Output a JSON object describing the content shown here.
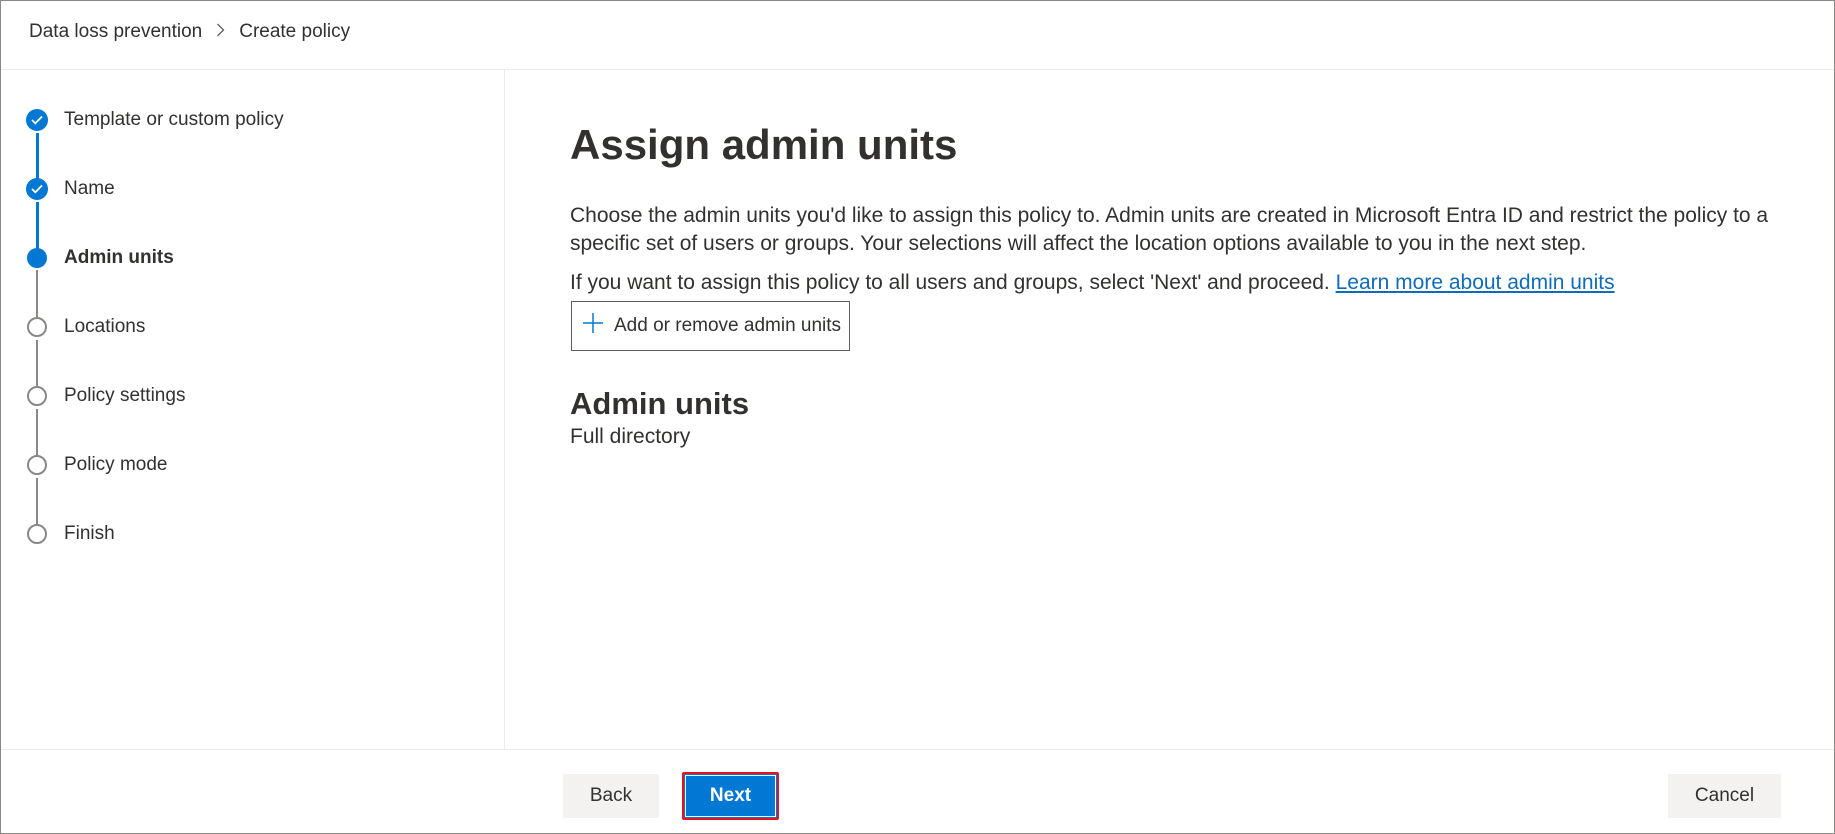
{
  "breadcrumb": {
    "items": [
      "Data loss prevention",
      "Create policy"
    ],
    "separator_icon": "chevron-right-icon"
  },
  "wizard": {
    "steps": [
      {
        "label": "Template or custom policy",
        "state": "completed"
      },
      {
        "label": "Name",
        "state": "completed"
      },
      {
        "label": "Admin units",
        "state": "current"
      },
      {
        "label": "Locations",
        "state": "not-started"
      },
      {
        "label": "Policy settings",
        "state": "not-started"
      },
      {
        "label": "Policy mode",
        "state": "not-started"
      },
      {
        "label": "Finish",
        "state": "not-started"
      }
    ]
  },
  "main": {
    "title": "Assign admin units",
    "description": "Choose the admin units you'd like to assign this policy to. Admin units are created in Microsoft Entra ID and restrict the policy to a specific set of users or groups. Your selections will affect the location options available to you in the next step.",
    "description2": "If you want to assign this policy to all users and groups, select 'Next' and proceed. ",
    "learn_more_link": "Learn more about admin units",
    "add_button_label": "Add or remove admin units",
    "section_title": "Admin units",
    "section_value": "Full directory"
  },
  "footer": {
    "back_label": "Back",
    "next_label": "Next",
    "cancel_label": "Cancel"
  },
  "colors": {
    "accent": "#0078d4",
    "highlight_border": "#e81123",
    "pending_step": "#8a8886",
    "link": "#0f6cbd"
  }
}
